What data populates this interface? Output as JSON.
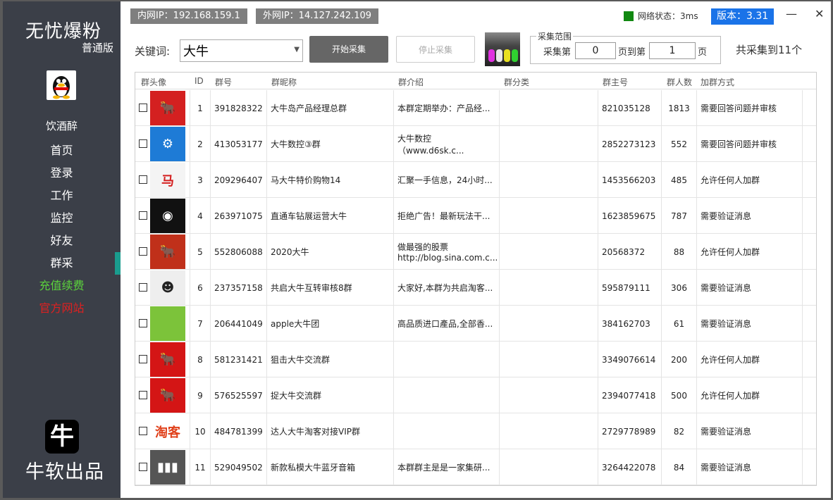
{
  "app": {
    "title": "无忧爆粉",
    "edition": "普通版",
    "brand": "牛软出品",
    "logo_char": "牛"
  },
  "sidebar": {
    "nickname": "饮酒醉",
    "items": [
      {
        "label": "首页"
      },
      {
        "label": "登录"
      },
      {
        "label": "工作"
      },
      {
        "label": "监控"
      },
      {
        "label": "好友"
      },
      {
        "label": "群采"
      },
      {
        "label": "充值续费"
      },
      {
        "label": "官方网站"
      }
    ]
  },
  "header": {
    "intranet_ip": "内网IP：192.168.159.1",
    "public_ip": "外网IP：14.127.242.109",
    "network_status": "网络状态：3ms",
    "version": "版本：3.31",
    "minimize": "—",
    "close": "✕"
  },
  "search": {
    "keyword_label": "关键词:",
    "keyword_value": "大牛",
    "start_label": "开始采集",
    "stop_label": "停止采集",
    "range_legend": "采集范围",
    "range_from_label": "采集第",
    "range_from_value": "0",
    "range_mid_label": "页到第",
    "range_to_value": "1",
    "range_end_label": "页",
    "total": "共采集到11个"
  },
  "table": {
    "headers": {
      "avatar": "群头像",
      "id": "ID",
      "group_no": "群号",
      "name": "群昵称",
      "intro": "群介绍",
      "category": "群分类",
      "owner": "群主号",
      "members": "群人数",
      "join": "加群方式"
    },
    "rows": [
      {
        "id": "1",
        "group_no": "391828322",
        "name": "大牛岛产品经理总群",
        "intro": "本群定期举办：产品经...",
        "category": "",
        "owner": "821035128",
        "members": "1813",
        "join": "需要回答问题并审核"
      },
      {
        "id": "2",
        "group_no": "413053177",
        "name": "大牛数控③群",
        "intro": "大牛数控（www.d6sk.c...",
        "category": "",
        "owner": "2852273123",
        "members": "552",
        "join": "需要回答问题并审核"
      },
      {
        "id": "3",
        "group_no": "209296407",
        "name": "马大牛特价购物14",
        "intro": "汇聚一手信息，24小时...",
        "category": "",
        "owner": "1453566203",
        "members": "485",
        "join": "允许任何人加群"
      },
      {
        "id": "4",
        "group_no": "263971075",
        "name": "直通车钻展运营大牛",
        "intro": "拒绝广告！最新玩法干...",
        "category": "",
        "owner": "1623859675",
        "members": "787",
        "join": "需要验证消息"
      },
      {
        "id": "5",
        "group_no": "552806088",
        "name": "2020大牛",
        "intro": "做最强的股票\nhttp://blog.sina.com.c...",
        "category": "",
        "owner": "20568372",
        "members": "88",
        "join": "允许任何人加群"
      },
      {
        "id": "6",
        "group_no": "237357158",
        "name": "共启大牛互转审核8群",
        "intro": "大家好,本群为共启淘客...",
        "category": "",
        "owner": "595879111",
        "members": "306",
        "join": "需要验证消息"
      },
      {
        "id": "7",
        "group_no": "206441049",
        "name": "apple大牛团",
        "intro": "高品质进口產品,全部香...",
        "category": "",
        "owner": "384162703",
        "members": "61",
        "join": "需要验证消息"
      },
      {
        "id": "8",
        "group_no": "581231421",
        "name": "狙击大牛交流群",
        "intro": "",
        "category": "",
        "owner": "3349076614",
        "members": "200",
        "join": "允许任何人加群"
      },
      {
        "id": "9",
        "group_no": "576525597",
        "name": "捉大牛交流群",
        "intro": "",
        "category": "",
        "owner": "2394077418",
        "members": "500",
        "join": "允许任何人加群"
      },
      {
        "id": "10",
        "group_no": "484781399",
        "name": "达人大牛淘客对接VIP群",
        "intro": "",
        "category": "",
        "owner": "2729778989",
        "members": "82",
        "join": "需要验证消息"
      },
      {
        "id": "11",
        "group_no": "529049502",
        "name": "新款私模大牛蓝牙音箱",
        "intro": "本群群主是是一家集研...",
        "category": "",
        "owner": "3264422078",
        "members": "84",
        "join": "需要验证消息"
      }
    ],
    "icons": [
      {
        "name": "bull-logo-icon",
        "bg": "#d42020",
        "glyph": "🐂"
      },
      {
        "name": "cnc-gear-icon",
        "bg": "#1e7bd6",
        "glyph": "⚙"
      },
      {
        "name": "horse-char-icon",
        "bg": "#f4f4f4",
        "glyph": "马",
        "fg": "#d42020"
      },
      {
        "name": "portrait-icon",
        "bg": "#111111",
        "glyph": "◉"
      },
      {
        "name": "golden-bull-icon",
        "bg": "#c0301a",
        "glyph": "🐂"
      },
      {
        "name": "masked-man-icon",
        "bg": "#eeeeee",
        "glyph": "☻",
        "fg": "#222222"
      },
      {
        "name": "apple-logo-icon",
        "bg": "#7cc33a",
        "glyph": ""
      },
      {
        "name": "bull-stock-icon",
        "bg": "#d41515",
        "glyph": "🐂"
      },
      {
        "name": "bull-stock-icon",
        "bg": "#d41515",
        "glyph": "🐂"
      },
      {
        "name": "taoke-badge-icon",
        "bg": "#ffffff",
        "glyph": "淘客",
        "fg": "#e0401a"
      },
      {
        "name": "speaker-product-icon",
        "bg": "#555555",
        "glyph": "▮▮▮"
      }
    ]
  }
}
